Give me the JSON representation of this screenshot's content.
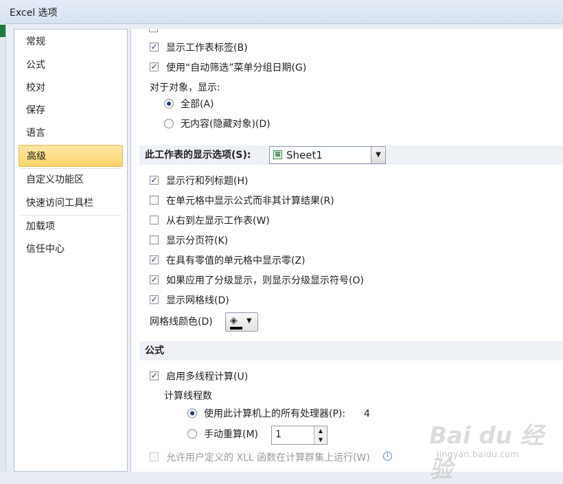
{
  "window": {
    "title": "Excel 选项"
  },
  "nav": {
    "items": [
      {
        "label": "常规",
        "selected": false
      },
      {
        "label": "公式",
        "selected": false
      },
      {
        "label": "校对",
        "selected": false
      },
      {
        "label": "保存",
        "selected": false
      },
      {
        "label": "语言",
        "selected": false
      },
      {
        "label": "高级",
        "selected": true
      },
      {
        "label": "自定义功能区",
        "selected": false
      },
      {
        "label": "快速访问工具栏",
        "selected": false
      },
      {
        "label": "加载项",
        "selected": false
      },
      {
        "label": "信任中心",
        "selected": false
      }
    ]
  },
  "display": {
    "show_sheet_tabs": {
      "label": "显示工作表标签(B)",
      "checked": true
    },
    "group_dates": {
      "label": "使用“自动筛选”菜单分组日期(G)",
      "checked": true
    },
    "objects_label": "对于对象，显示:",
    "objects_all": {
      "label": "全部(A)",
      "selected": true
    },
    "objects_none": {
      "label": "无内容(隐藏对象)(D)",
      "selected": false
    }
  },
  "worksheet": {
    "section_label": "此工作表的显示选项(S):",
    "sheet_value": "Sheet1",
    "options": [
      {
        "label": "显示行和列标题(H)",
        "checked": true
      },
      {
        "label": "在单元格中显示公式而非其计算结果(R)",
        "checked": false
      },
      {
        "label": "从右到左显示工作表(W)",
        "checked": false
      },
      {
        "label": "显示分页符(K)",
        "checked": false
      },
      {
        "label": "在具有零值的单元格中显示零(Z)",
        "checked": true
      },
      {
        "label": "如果应用了分级显示，则显示分级显示符号(O)",
        "checked": true
      },
      {
        "label": "显示网格线(D)",
        "checked": true
      }
    ],
    "gridline_color_label": "网格线颜色(D)",
    "gridline_color": "#000000"
  },
  "formulas": {
    "section_label": "公式",
    "multithread": {
      "label": "启用多线程计算(U)",
      "checked": true
    },
    "threads_label": "计算线程数",
    "all_processors": {
      "label": "使用此计算机上的所有处理器(P):",
      "selected": true,
      "value": "4"
    },
    "manual": {
      "label": "手动重算(M)",
      "selected": false,
      "value": "1"
    },
    "xll": {
      "label": "允许用户定义的 XLL 函数在计算群集上运行(W)",
      "checked": false,
      "disabled": true
    }
  },
  "watermark": {
    "text": "Bai du 经验",
    "sub": "jingyan.baidu.com"
  },
  "icons": {
    "check": "✓",
    "bucket": "paint-bucket-icon",
    "info": "info-icon"
  }
}
